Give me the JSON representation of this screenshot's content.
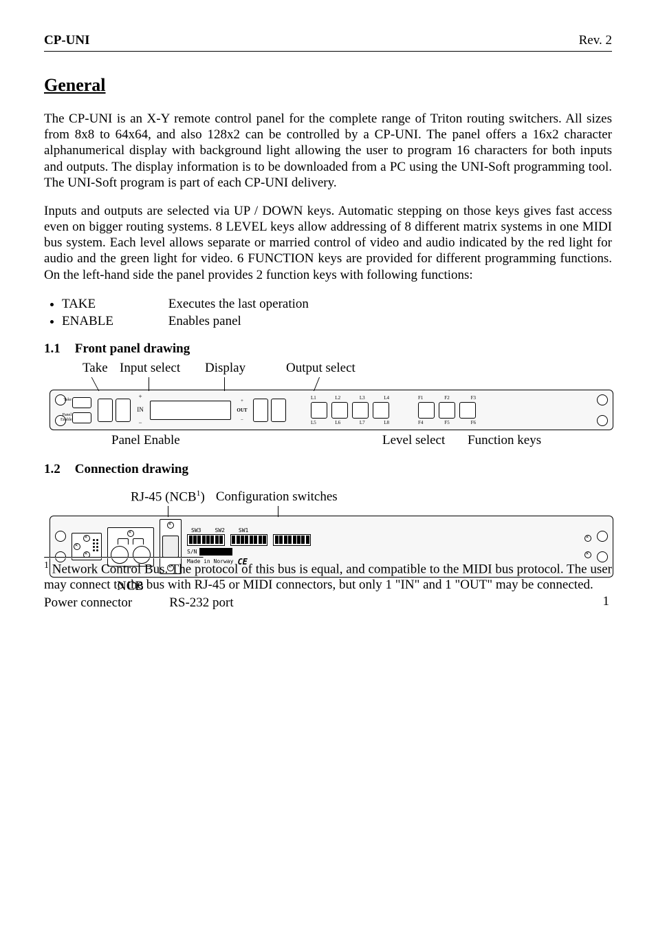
{
  "header": {
    "left": "CP-UNI",
    "right": "Rev. 2"
  },
  "section_title": "General",
  "para1": "The CP-UNI is an X-Y remote control panel for the complete range of Triton routing switchers. All sizes from 8x8 to 64x64, and also 128x2 can be controlled by a CP-UNI. The panel offers a 16x2 character alphanumerical display with background light allowing the user to program 16 characters for both inputs and outputs. The display information is to be downloaded from a PC using the UNI-Soft programming tool. The UNI-Soft program is part of each CP-UNI delivery.",
  "para2": "Inputs and outputs are selected via UP / DOWN keys. Automatic stepping on those keys gives fast access even on bigger routing systems. 8 LEVEL keys allow addressing of 8 different matrix systems in one MIDI bus system. Each level allows separate or married control of video and audio indicated by the red light for audio and the green light for video. 6 FUNCTION keys are provided for different programming functions. On the left-hand side the panel provides 2 function keys with following functions:",
  "bullets": [
    {
      "label": "TAKE",
      "desc": "Executes the last operation"
    },
    {
      "label": "ENABLE",
      "desc": "Enables panel"
    }
  ],
  "sub1": {
    "num": "1.1",
    "title": "Front panel drawing"
  },
  "front_top": {
    "take": "Take",
    "input_select": "Input select",
    "display": "Display",
    "output_select": "Output select"
  },
  "front_bottom": {
    "panel_enable": "Panel Enable",
    "level_select": "Level select",
    "function_keys": "Function keys"
  },
  "front_panel": {
    "btn_take": "Take",
    "btn_enable": "Panel Enable",
    "in_up": "+",
    "in_mid": "IN",
    "in_down": "−",
    "out_up": "+",
    "out_lbl": "OUT",
    "out_down": "−",
    "levels_top": [
      "L1",
      "L2",
      "L3",
      "L4"
    ],
    "levels_bottom": [
      "L5",
      "L6",
      "L7",
      "L8"
    ],
    "fns_top": [
      "F1",
      "F2",
      "F3"
    ],
    "fns_bottom": [
      "F4",
      "F5",
      "F6"
    ]
  },
  "sub2": {
    "num": "1.2",
    "title": "Connection drawing"
  },
  "rear_top": {
    "rj45_pre": "RJ-45 (NCB",
    "rj45_sup": "1",
    "rj45_post": ")",
    "config": "Configuration switches"
  },
  "rear_panel": {
    "sw_labels": [
      "SW3",
      "SW2",
      "SW1"
    ],
    "sn_label": "S/N",
    "made_in": "Made in Norway",
    "ce": "CE"
  },
  "rear_bottom": {
    "ncb": "NCB",
    "power": "Power connector",
    "rs232": "RS-232 port"
  },
  "footnote": {
    "num": "1",
    "text": " Network Control Bus. The protocol of this bus is equal, and compatible to the MIDI bus protocol. The user may connect to the bus with RJ-45 or MIDI connectors, but only 1 \"IN\" and 1 \"OUT\" may be connected."
  },
  "page_number": "1"
}
